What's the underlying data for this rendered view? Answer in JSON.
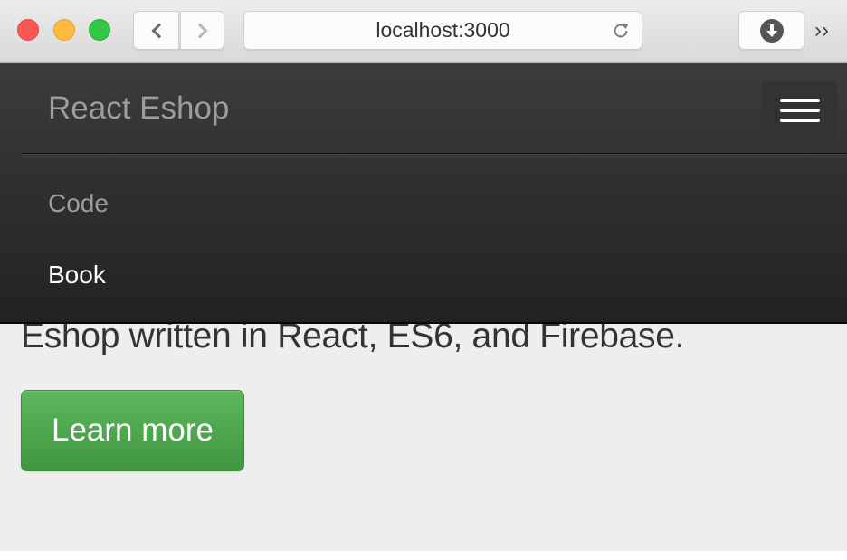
{
  "browser": {
    "url": "localhost:3000",
    "icons": {
      "close": "close-window-icon",
      "minimize": "minimize-window-icon",
      "zoom": "zoom-window-icon",
      "back": "chevron-left-icon",
      "forward": "chevron-right-icon",
      "reload": "reload-icon",
      "download": "download-icon",
      "more": "double-chevron-right-icon"
    },
    "more_label": "››"
  },
  "navbar": {
    "brand": "React Eshop",
    "toggle_icon": "hamburger-menu-icon",
    "items": [
      {
        "label": "Code",
        "active": false
      },
      {
        "label": "Book",
        "active": true
      }
    ]
  },
  "jumbotron": {
    "lead": "Eshop written in React, ES6, and Firebase.",
    "button_label": "Learn more",
    "button_color": "#5cb85c"
  }
}
